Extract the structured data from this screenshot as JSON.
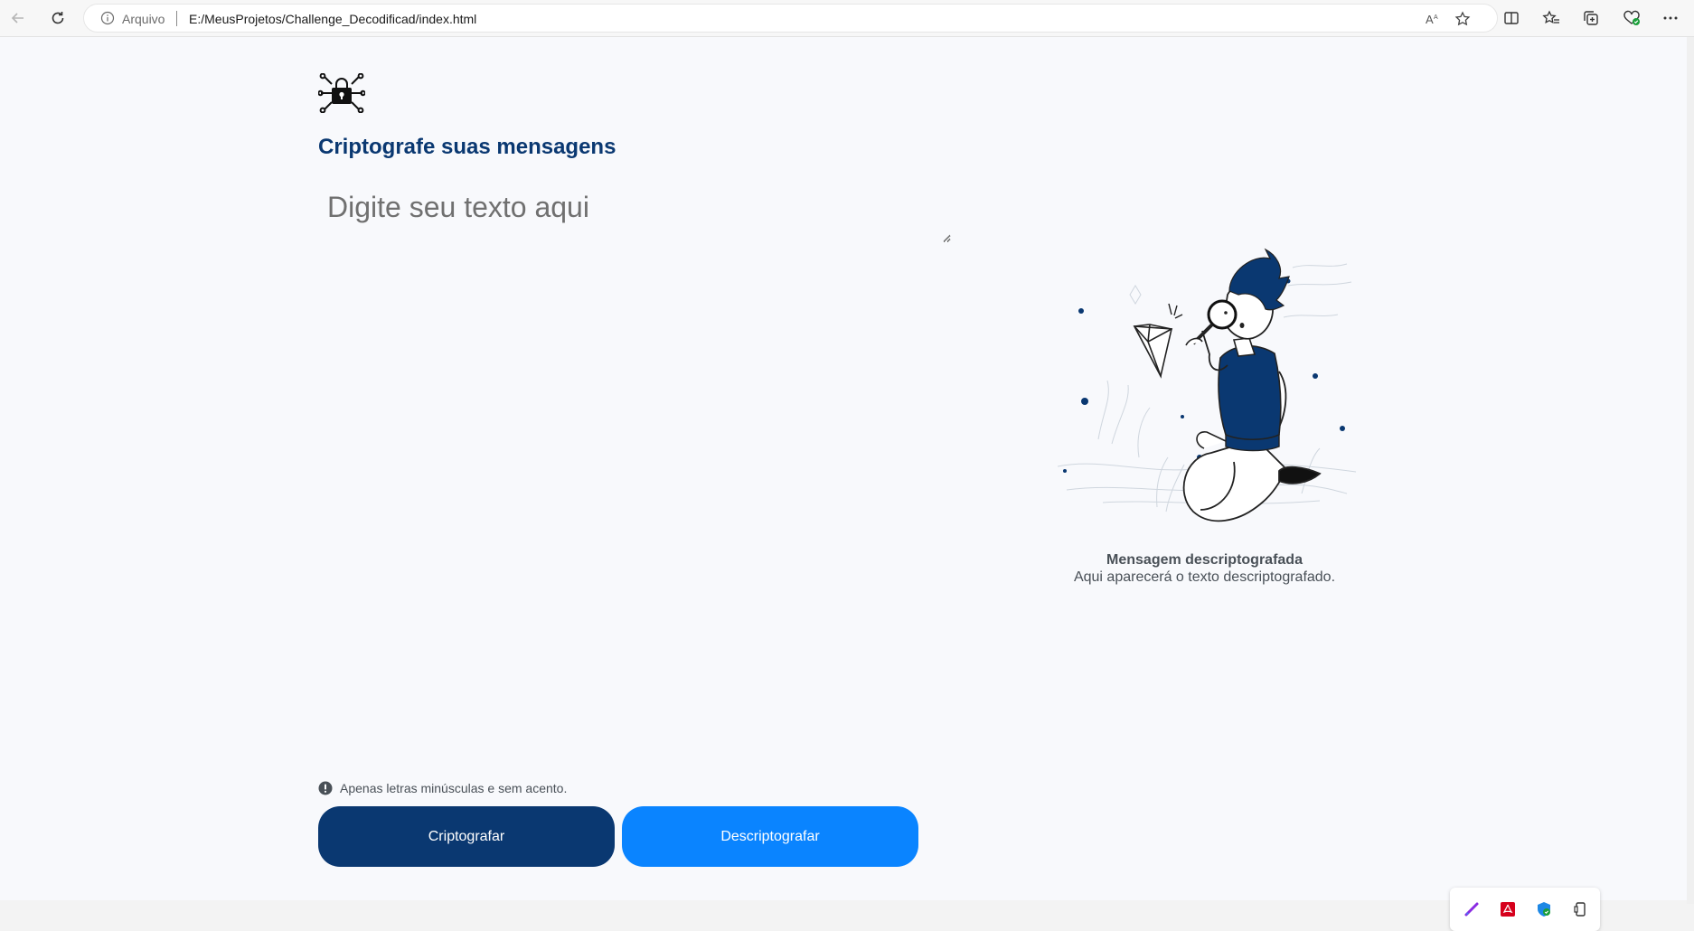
{
  "browser": {
    "protocol_label": "Arquivo",
    "url": "E:/MeusProjetos/Challenge_Decodificad/index.html",
    "toolbar_icons": [
      "back-icon",
      "refresh-icon",
      "read-aloud-icon",
      "favorite-star-icon",
      "split-screen-icon",
      "favorites-icon",
      "collections-icon",
      "browser-essentials-icon",
      "more-icon"
    ]
  },
  "page": {
    "logo_icon": "padlock-circuit-icon",
    "title": "Criptografe suas mensagens",
    "input_placeholder": "Digite seu texto aqui",
    "illustration": "person-with-magnifier-illustration",
    "message_title": "Mensagem descriptografada",
    "message_text": "Aqui aparecerá o texto descriptografado.",
    "hint_text": "Apenas letras minúsculas e sem acento.",
    "encrypt_button": "Criptografar",
    "decrypt_button": "Descriptografar"
  },
  "tray_icons": [
    "pen-icon",
    "pdf-icon",
    "shield-icon",
    "phone-icon"
  ],
  "colors": {
    "primary": "#0a3871",
    "accent": "#0a84ff",
    "page_bg": "#f8f9fc",
    "text_muted": "#495057"
  }
}
